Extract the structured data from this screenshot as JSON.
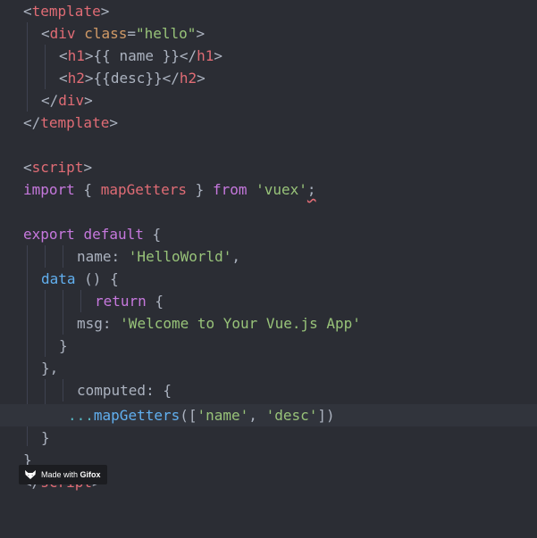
{
  "colors": {
    "background": "#2b2d34",
    "active_line": "#31343c",
    "tag": "#e06c75",
    "attribute": "#d19a66",
    "string": "#98c379",
    "keyword": "#c678dd",
    "function": "#61afef",
    "plain": "#abb2bf"
  },
  "code": {
    "l1": {
      "lt": "<",
      "tag": "template",
      "gt": ">"
    },
    "l2": {
      "lt": "<",
      "tag": "div",
      "sp": " ",
      "attr": "class",
      "eq": "=",
      "val": "\"hello\"",
      "gt": ">"
    },
    "l3": {
      "lt": "<",
      "tag": "h1",
      "gt": ">",
      "expr": "{{ name }}",
      "lt2": "</",
      "tag2": "h1",
      "gt2": ">"
    },
    "l4": {
      "lt": "<",
      "tag": "h2",
      "gt": ">",
      "expr": "{{desc}}",
      "lt2": "</",
      "tag2": "h2",
      "gt2": ">"
    },
    "l5": {
      "lt": "</",
      "tag": "div",
      "gt": ">"
    },
    "l6": {
      "lt": "</",
      "tag": "template",
      "gt": ">"
    },
    "l8": {
      "lt": "<",
      "tag": "script",
      "gt": ">"
    },
    "l9": {
      "kw": "import",
      "p1": " { ",
      "fn": "mapGetters",
      "p2": " } ",
      "kw2": "from",
      "sp": " ",
      "str": "'vuex'",
      "semi": ";"
    },
    "l11": {
      "kw": "export",
      "sp": " ",
      "kw2": "default",
      "p": " {"
    },
    "l12": {
      "prop": "name",
      "colon": ": ",
      "str": "'HelloWorld'",
      "comma": ","
    },
    "l13": {
      "fn": "data",
      "p": " () {"
    },
    "l14": {
      "kw": "return",
      "p": " {"
    },
    "l15": {
      "prop": "msg",
      "colon": ": ",
      "str": "'Welcome to Your Vue.js App'"
    },
    "l16": {
      "p": "}"
    },
    "l17": {
      "p": "},"
    },
    "l18": {
      "prop": "computed",
      "colon": ": ",
      "p": "{"
    },
    "l19": {
      "spread": "...",
      "fn": "mapGetters",
      "p1": "([",
      "str1": "'name'",
      "p2": ", ",
      "str2": "'desc'",
      "p3": "])"
    },
    "l20": {
      "p": "}"
    },
    "l21": {
      "p": "}"
    },
    "l22": {
      "lt": "</",
      "tag": "script",
      "gt": ">"
    }
  },
  "badge": {
    "prefix": "Made with ",
    "brand": "Gifox",
    "icon": "fox-icon"
  }
}
